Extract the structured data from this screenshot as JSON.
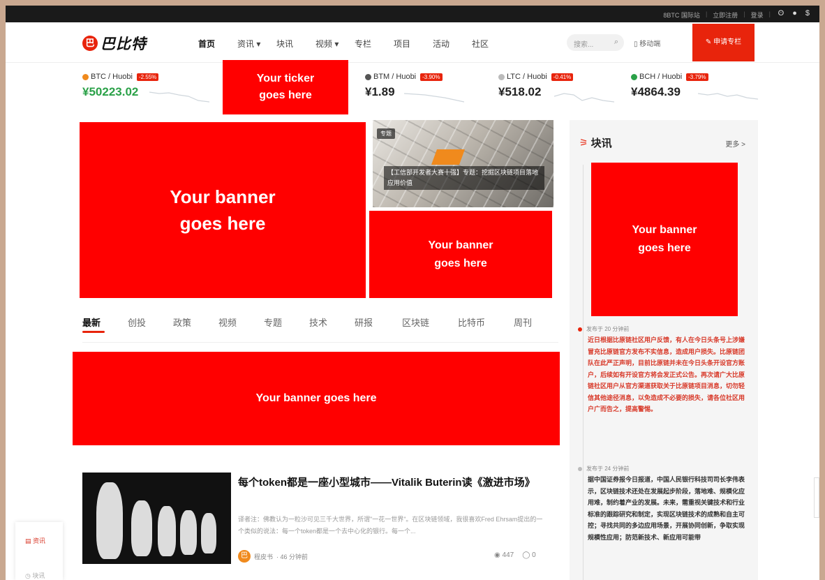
{
  "topbar": {
    "links": [
      "8BTC 国际站",
      "立即注册",
      "登录",
      "注册"
    ],
    "icons": [
      "weibo-icon",
      "wechat-icon",
      "coin-icon"
    ]
  },
  "nav": {
    "logo_mark": "巴",
    "logo_text": "巴比特",
    "menu": [
      "首页",
      "资讯 ▾",
      "块讯",
      "视频 ▾",
      "专栏",
      "项目",
      "活动",
      "社区"
    ],
    "search_placeholder": "搜索...",
    "mobile": "▯ 移动端",
    "apply": "✎ 申请专栏"
  },
  "tickers": [
    {
      "pair": "BTC / Huobi",
      "change": "-2.55%",
      "price": "¥50223.02",
      "dot": "#f08a1d",
      "price_color": "#2aa148"
    },
    {
      "pair": "BTM / Huobi",
      "change": "-3.90%",
      "price": "¥1.89",
      "dot": "#555555",
      "price_color": "#222222"
    },
    {
      "pair": "LTC / Huobi",
      "change": "-0.41%",
      "price": "¥518.02",
      "dot": "#bbbbbb",
      "price_color": "#222222"
    },
    {
      "pair": "BCH / Huobi",
      "change": "-3.79%",
      "price": "¥4864.39",
      "dot": "#2aa148",
      "price_color": "#222222"
    }
  ],
  "ads": {
    "ticker": "Your ticker\ngoes here",
    "banner_main": "Your banner\ngoes here",
    "banner_small": "Your banner\ngoes here",
    "banner_side": "Your banner\ngoes here",
    "banner_wide": "Your banner goes here"
  },
  "feature": {
    "tag": "专题",
    "caption": "【工信部开发者大赛十强】专题：挖掘区块链项目落地应用价值"
  },
  "sidebar": {
    "title": "块讯",
    "more": "更多 >",
    "news": [
      {
        "time": "发布于 20 分钟前",
        "text": "近日根据比原链社区用户反馈，有人在今日头条号上涉嫌冒充比原链官方发布不实信息，造成用户损失。比原链团队在此严正声明，目前比原链并未在今日头条开设官方账户，后续如有开设官方将会发正式公告。再次请广大比原链社区用户从官方渠道获取关于比原链项目消息，切勿轻信其他途径消息，以免造成不必要的损失，请各位社区用户广而告之，提高警惕。"
      },
      {
        "time": "发布于 24 分钟前",
        "text": "据中国证券报今日报道，中国人民银行科技司司长李伟表示，区块链技术还处在发展起步阶段，落地难、规模化应用难，制约着产业的发展。未来，需重视关键技术和行业标准的跟踪研究和制定，实现区块链技术的成熟和自主可控；寻找共同的多边应用场景，开展协同创新，争取实现规模性应用；防范新技术、新应用可能带"
      }
    ]
  },
  "tabs": [
    "最新",
    "创投",
    "政策",
    "视频",
    "专题",
    "技术",
    "研报",
    "区块链",
    "比特币",
    "周刊"
  ],
  "article": {
    "title": "每个token都是一座小型城市——Vitalik Buterin读《激进市场》",
    "summary": "译者注：佛教认为一粒沙可见三千大世界，所谓\"一花一世界\"。在区块链领域，我很喜欢Fred Ehrsam提出的一个类似的说法：每一个token都是一个去中心化的银行。每一个...",
    "author_avatar": "巴",
    "author": "程皮书",
    "time": "· 46 分钟前",
    "views": "◉ 447",
    "comments": "◯ 0"
  },
  "floating": {
    "item1": "▤ 资讯",
    "item2": "◷ 块讯"
  }
}
